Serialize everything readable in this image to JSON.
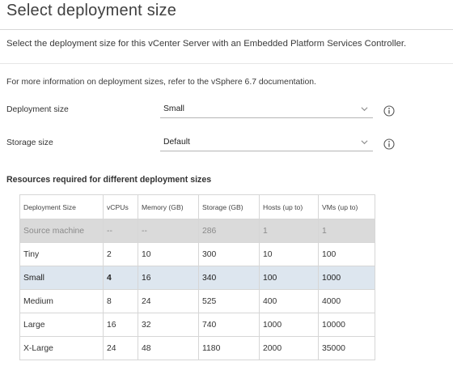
{
  "page": {
    "title": "Select deployment size",
    "subtitle": "Select the deployment size for this vCenter Server with an Embedded Platform Services Controller.",
    "info_text": "For more information on deployment sizes, refer to the vSphere 6.7 documentation."
  },
  "form": {
    "deployment_size": {
      "label": "Deployment size",
      "value": "Small"
    },
    "storage_size": {
      "label": "Storage size",
      "value": "Default"
    }
  },
  "resources": {
    "heading": "Resources required for different deployment sizes",
    "columns": [
      "Deployment Size",
      "vCPUs",
      "Memory (GB)",
      "Storage (GB)",
      "Hosts (up to)",
      "VMs (up to)"
    ],
    "rows": [
      [
        "Source machine",
        "--",
        "--",
        "286",
        "1",
        "1"
      ],
      [
        "Tiny",
        "2",
        "10",
        "300",
        "10",
        "100"
      ],
      [
        "Small",
        "4",
        "16",
        "340",
        "100",
        "1000"
      ],
      [
        "Medium",
        "8",
        "24",
        "525",
        "400",
        "4000"
      ],
      [
        "Large",
        "16",
        "32",
        "740",
        "1000",
        "10000"
      ],
      [
        "X-Large",
        "24",
        "48",
        "1180",
        "2000",
        "35000"
      ]
    ],
    "disabled_row": "Source machine",
    "selected_row": "Small"
  },
  "icons": {
    "dropdown": "chevron-down-icon",
    "info": "info-icon"
  },
  "colors": {
    "selected_row_bg": "#dde6ef",
    "disabled_row_bg": "#dadada"
  }
}
